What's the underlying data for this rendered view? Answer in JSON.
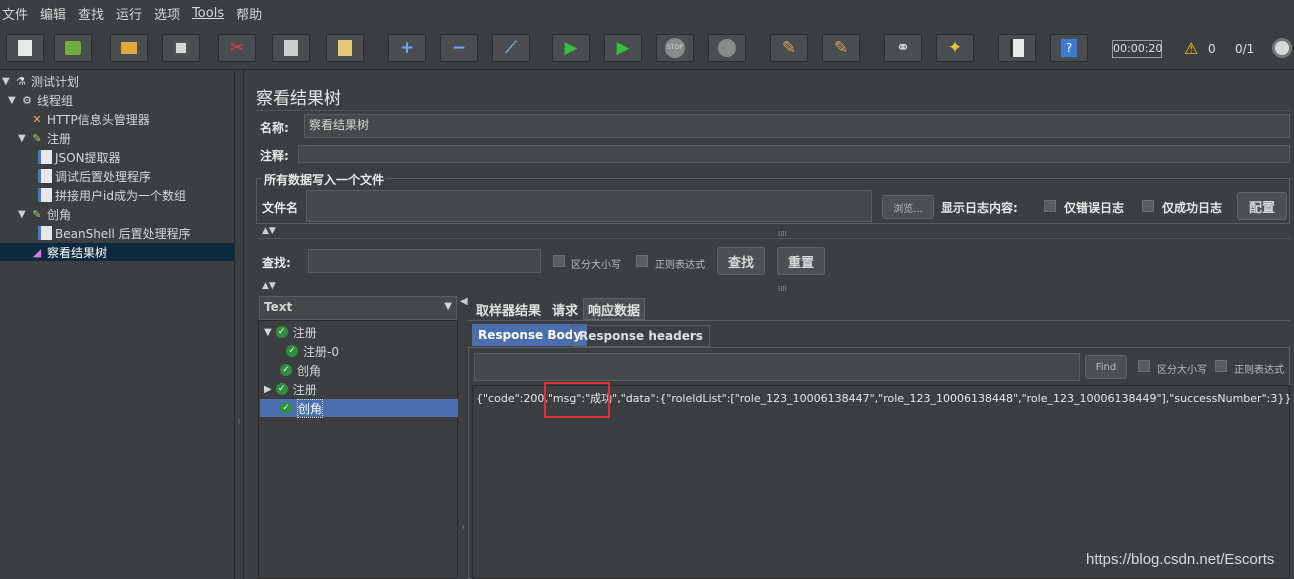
{
  "menu": [
    "文件",
    "编辑",
    "查找",
    "运行",
    "选项",
    "Tools",
    "帮助"
  ],
  "toolbar": {
    "icons": [
      "new-icon",
      "template-icon",
      "open-icon",
      "save-icon",
      "cut-icon",
      "copy-icon",
      "paste-icon",
      "expand-icon",
      "collapse-icon",
      "toggle-icon",
      "start-icon",
      "start-no-pause-icon",
      "stop-icon",
      "shutdown-icon",
      "clear-icon",
      "clear-all-icon",
      "search-icon",
      "reset-search-icon",
      "function-helper-icon",
      "help-icon"
    ],
    "timer": "00:00:20",
    "warnings": "0",
    "threads": "0/1"
  },
  "tree": {
    "items": [
      {
        "label": "测试计划",
        "icon": "test-plan-icon"
      },
      {
        "label": "线程组",
        "icon": "gear-icon"
      },
      {
        "label": "HTTP信息头管理器",
        "icon": "wrench-icon"
      },
      {
        "label": "注册",
        "icon": "pen-icon"
      },
      {
        "label": "JSON提取器",
        "icon": "doc-icon"
      },
      {
        "label": "调试后置处理程序",
        "icon": "doc-icon"
      },
      {
        "label": "拼接用户id成为一个数组",
        "icon": "doc-icon"
      },
      {
        "label": "创角",
        "icon": "pen-icon"
      },
      {
        "label": "BeanShell 后置处理程序",
        "icon": "doc-icon"
      },
      {
        "label": "察看结果树",
        "icon": "chart-icon"
      }
    ]
  },
  "panel": {
    "title": "察看结果树",
    "name_label": "名称:",
    "name_value": "察看结果树",
    "comment_label": "注释:",
    "section_title": "所有数据写入一个文件",
    "file_label": "文件名",
    "browse": "浏览...",
    "log_label": "显示日志内容:",
    "errors_only": "仅错误日志",
    "success_only": "仅成功日志",
    "configure": "配置",
    "search_label": "查找:",
    "case_sensitive": "区分大小写",
    "regex": "正则表达式",
    "find_btn": "查找",
    "reset_btn": "重置"
  },
  "results": {
    "renderer": "Text",
    "nodes": [
      {
        "label": "注册",
        "expanded": true
      },
      {
        "label": "注册-0"
      },
      {
        "label": "创角"
      },
      {
        "label": "注册",
        "expanded": false
      },
      {
        "label": "创角",
        "selected": true
      }
    ],
    "tabs": [
      "取样器结果",
      "请求",
      "响应数据"
    ],
    "subtabs": [
      "Response Body",
      "Response headers"
    ],
    "find": "Find",
    "case_sensitive": "区分大小写",
    "regex": "正则表达式",
    "body": "{\"code\":200,\"msg\":\"成功\",\"data\":{\"roleIdList\":[\"role_123_10006138447\",\"role_123_10006138448\",\"role_123_10006138449\"],\"successNumber\":3}}"
  },
  "watermark": "https://blog.csdn.net/Escorts"
}
